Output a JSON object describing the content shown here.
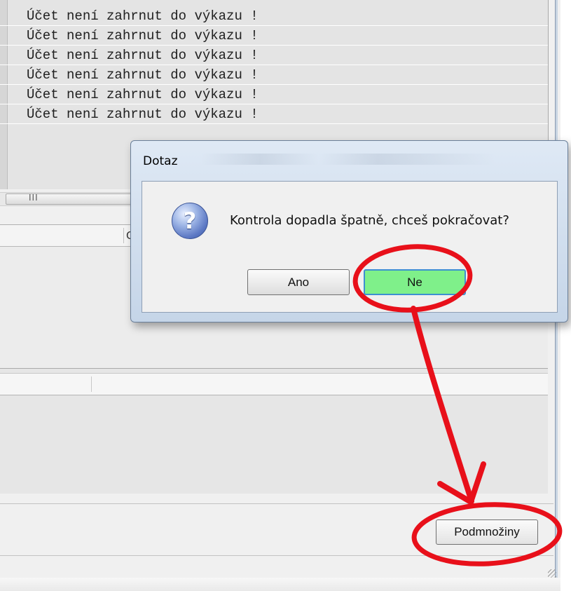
{
  "error_list": {
    "rows": [
      "Účet není zahrnut do výkazu !",
      "Účet není zahrnut do výkazu !",
      "Účet není zahrnut do výkazu !",
      "Účet není zahrnut do výkazu !",
      "Účet není zahrnut do výkazu !",
      "Účet není zahrnut do výkazu !"
    ],
    "scrollbar_grip": "III"
  },
  "panel2": {
    "column_fragment": "C"
  },
  "footer": {
    "subsets_label": "Podmnožiny"
  },
  "dialog": {
    "title": "Dotaz",
    "message": "Kontrola dopadla špatně, chceš pokračovat?",
    "icon": "question-icon",
    "yes_label": "Ano",
    "no_label": "Ne"
  },
  "annotation": {
    "color": "#e8101a",
    "highlight_color": "#7ff08a"
  }
}
